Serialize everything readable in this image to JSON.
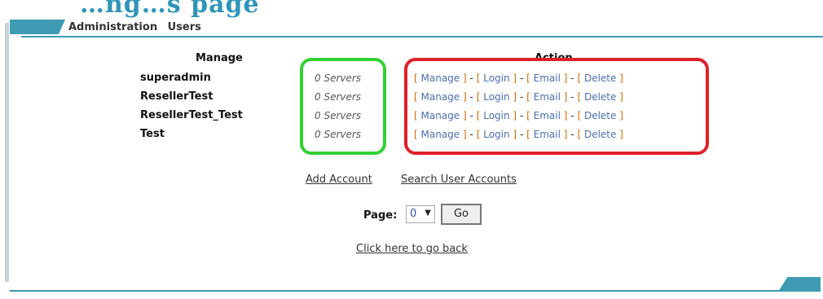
{
  "page_title": "…ng…s page",
  "breadcrumb": [
    "Administration",
    "Users"
  ],
  "columns": {
    "manage": "Manage",
    "action": "Action"
  },
  "users": [
    {
      "name": "superadmin",
      "servers": "0 Servers"
    },
    {
      "name": "ResellerTest",
      "servers": "0 Servers"
    },
    {
      "name": "ResellerTest_Test",
      "servers": "0 Servers"
    },
    {
      "name": "Test",
      "servers": "0 Servers"
    }
  ],
  "actions": {
    "manage": "Manage",
    "login": "Login",
    "email": "Email",
    "delete": "Delete"
  },
  "links": {
    "add_account": "Add Account",
    "search_accounts": "Search User Accounts",
    "go_back": "Click here to go back"
  },
  "pagination": {
    "label": "Page:",
    "value": "0",
    "go": "Go"
  },
  "colors": {
    "accent": "#3e9bb3",
    "highlight_green": "#32d132",
    "highlight_red": "#e0202a"
  }
}
